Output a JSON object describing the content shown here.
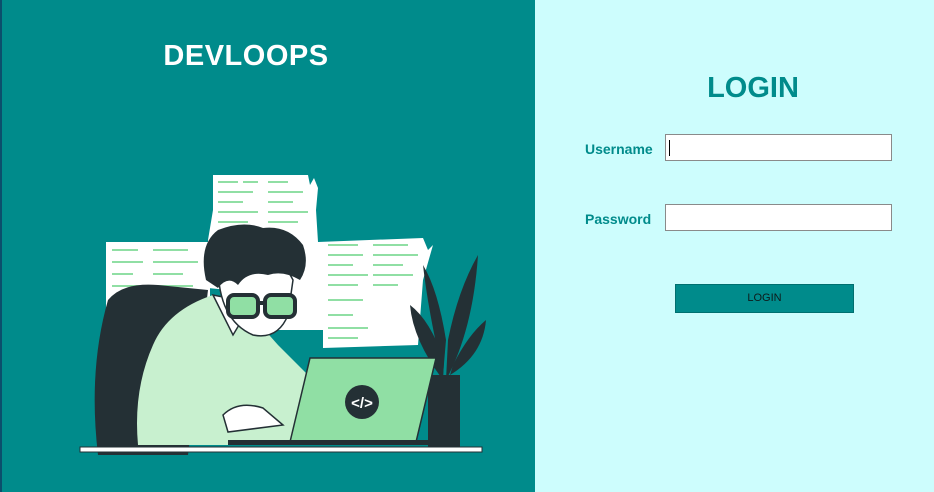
{
  "brand": {
    "title": "DEVLOOPS"
  },
  "login": {
    "title": "LOGIN",
    "username_label": "Username",
    "username_value": "",
    "password_label": "Password",
    "password_value": "",
    "button_label": "LOGIN"
  },
  "colors": {
    "left_panel": "#008b8b",
    "right_panel": "#cdfdfd",
    "accent": "#008b8b",
    "illustration_green": "#90dfa4",
    "illustration_dark": "#243035"
  },
  "illustration": {
    "icon": "developer-at-laptop-illustration",
    "laptop_glyph": "</>"
  }
}
